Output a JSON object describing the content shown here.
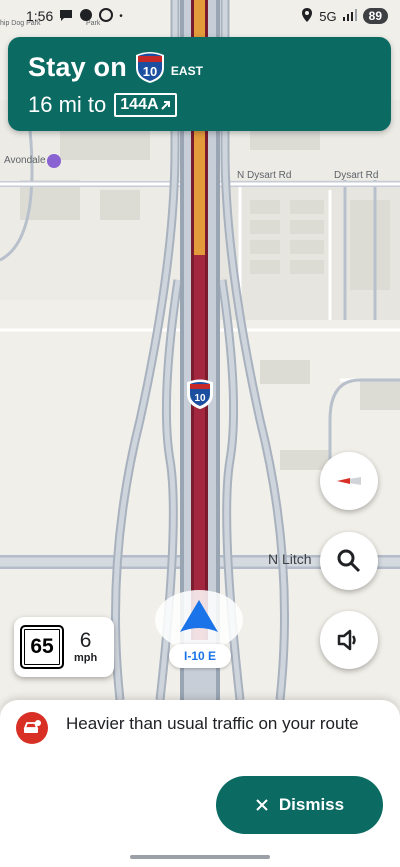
{
  "status_bar": {
    "time": "1:56",
    "network": "5G",
    "battery": "89",
    "icons": [
      "chat-icon",
      "location-icon",
      "signal-icon"
    ]
  },
  "map": {
    "labels": {
      "avondale": "Avondale",
      "dysart_1": "N Dysart Rd",
      "dysart_2": "Dysart Rd",
      "litch": "N Litch",
      "dog_park": "hip Dog Park",
      "park": "Park"
    },
    "map_shield": "10"
  },
  "navigation": {
    "primary": "Stay on",
    "shield_number": "10",
    "shield_direction": "EAST",
    "distance": "16 mi to",
    "exit_label": "144A"
  },
  "speed": {
    "limit": "65",
    "current": "6",
    "unit": "mph"
  },
  "route_label": "I-10 E",
  "alert": {
    "message": "Heavier than usual traffic on your route",
    "dismiss_label": "Dismiss"
  },
  "colors": {
    "nav_green": "#0b6b62",
    "traffic_red": "#a3283f",
    "traffic_orange": "#e39b3c",
    "nav_blue": "#1a73e8"
  }
}
